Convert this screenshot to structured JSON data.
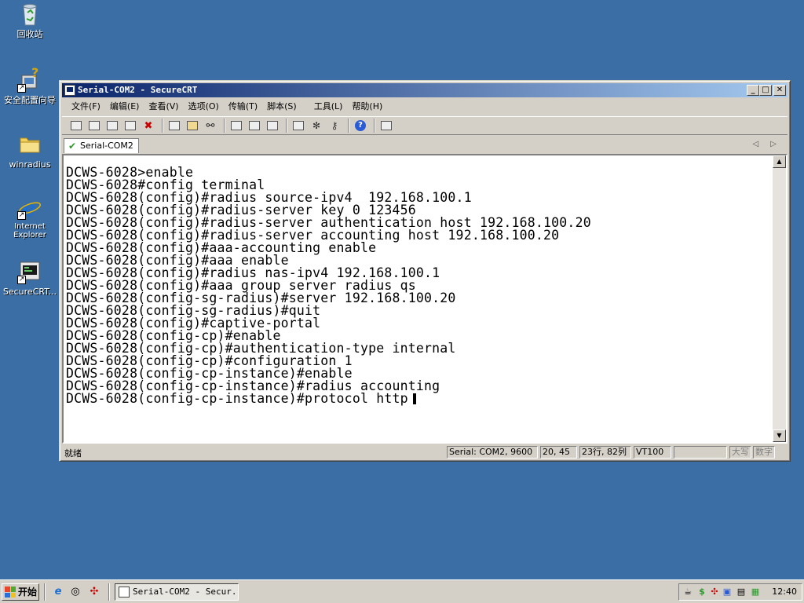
{
  "desktop": {
    "icons": [
      {
        "label": "回收站"
      },
      {
        "label": "安全配置向导"
      },
      {
        "label": "winradius"
      },
      {
        "label": "Internet Explorer"
      },
      {
        "label": "SecureCRT..."
      }
    ]
  },
  "window": {
    "title": "Serial-COM2 - SecureCRT",
    "controls": {
      "minimize": "_",
      "maximize": "□",
      "close": "✕"
    },
    "menu": [
      "文件(F)",
      "编辑(E)",
      "查看(V)",
      "选项(O)",
      "传输(T)",
      "脚本(S)",
      "工具(L)",
      "帮助(H)"
    ],
    "toolbar_icons": [
      "connect-icon",
      "quick-connect-icon",
      "connect-in-tab-icon",
      "reconnect-icon",
      "disconnect-icon",
      "copy-icon",
      "paste-icon",
      "find-icon",
      "print-icon",
      "print-selection-icon",
      "print-setup-icon",
      "session-options-icon",
      "global-options-icon",
      "keymap-icon",
      "help-icon",
      "sftp-icon"
    ],
    "tab": {
      "label": "Serial-COM2"
    },
    "tab_nav": "◁ ▷",
    "terminal": {
      "lines": [
        "DCWS-6028>enable",
        "DCWS-6028#config terminal",
        "DCWS-6028(config)#radius source-ipv4  192.168.100.1",
        "DCWS-6028(config)#radius-server key 0 123456",
        "DCWS-6028(config)#radius-server authentication host 192.168.100.20",
        "DCWS-6028(config)#radius-server accounting host 192.168.100.20",
        "DCWS-6028(config)#aaa-accounting enable",
        "DCWS-6028(config)#aaa enable",
        "DCWS-6028(config)#radius nas-ipv4 192.168.100.1",
        "DCWS-6028(config)#aaa group server radius qs",
        "DCWS-6028(config-sg-radius)#server 192.168.100.20",
        "DCWS-6028(config-sg-radius)#quit",
        "DCWS-6028(config)#captive-portal",
        "DCWS-6028(config-cp)#enable",
        "DCWS-6028(config-cp)#authentication-type internal",
        "DCWS-6028(config-cp)#configuration 1",
        "DCWS-6028(config-cp-instance)#enable",
        "DCWS-6028(config-cp-instance)#radius accounting",
        "DCWS-6028(config-cp-instance)#protocol http"
      ]
    },
    "scroll": {
      "up": "▲",
      "down": "▼"
    },
    "status": {
      "ready": "就绪",
      "connection": "Serial: COM2, 9600",
      "cursor_pos": "20, 45",
      "rows_cols": "23行, 82列",
      "emulation": "VT100",
      "blank": "",
      "caps": "大写",
      "num": "数字"
    }
  },
  "taskbar": {
    "start_label": "开始",
    "task_title": "Serial-COM2 - Secur...",
    "clock": "12:40",
    "colors": {
      "accent": "#0a246a",
      "desktop": "#3a6ea5"
    }
  }
}
